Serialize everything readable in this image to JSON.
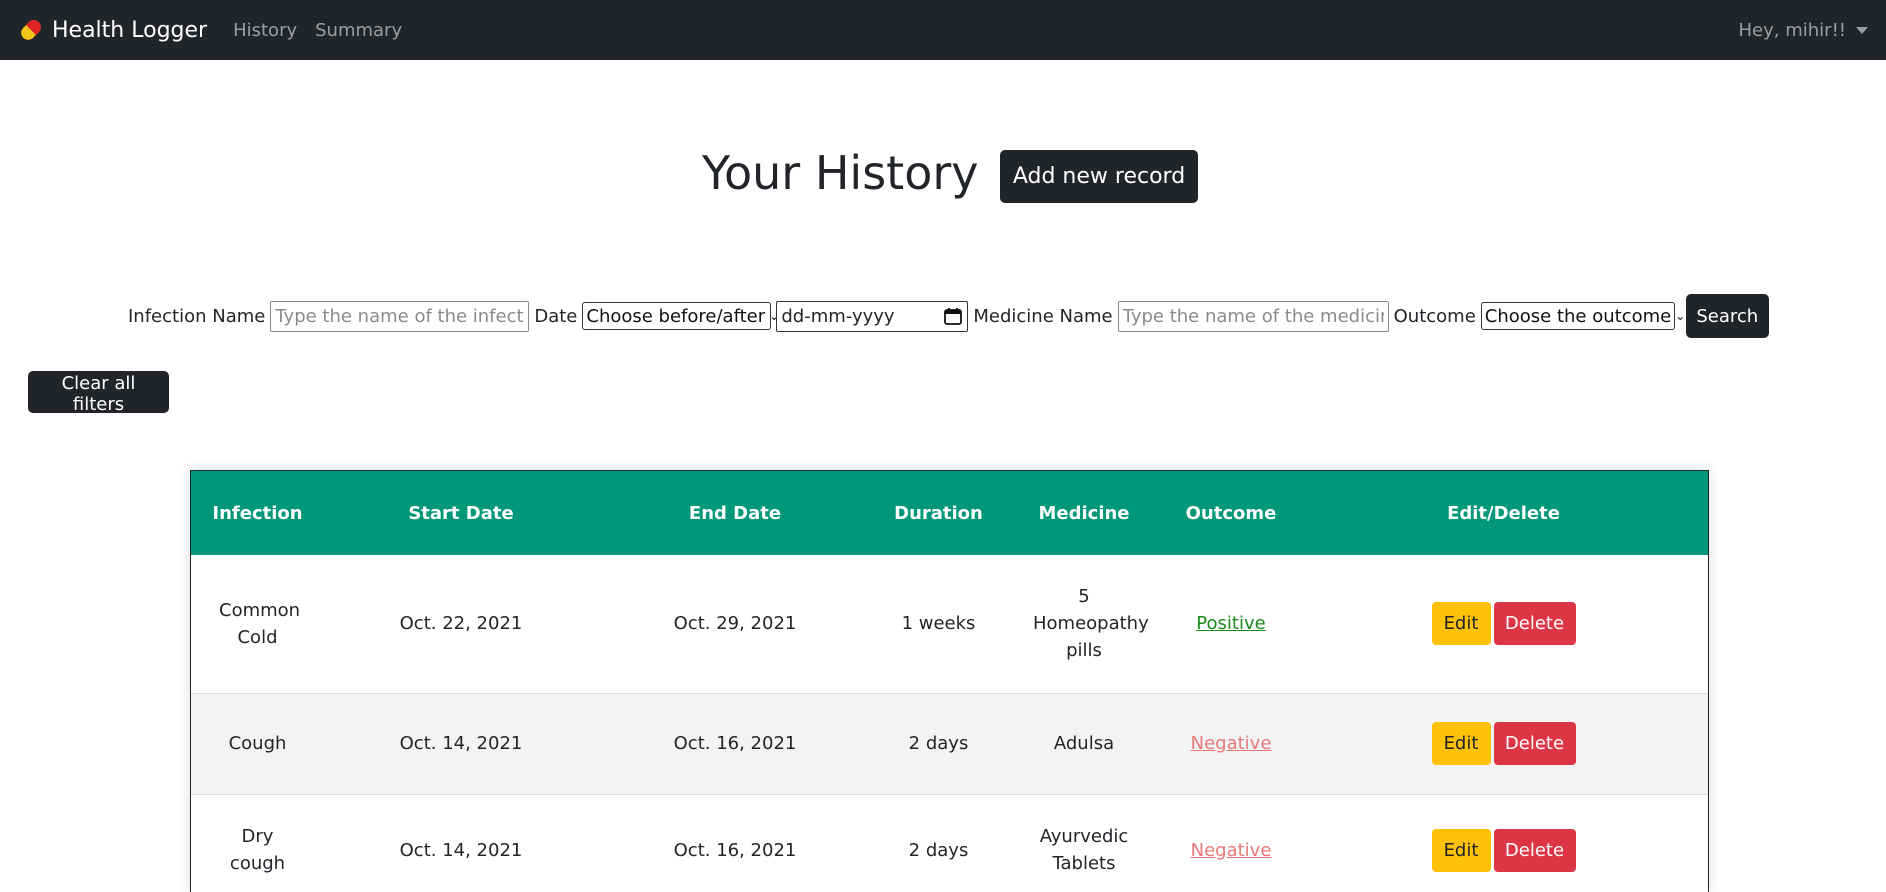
{
  "navbar": {
    "brand": "Health Logger",
    "links": [
      "History",
      "Summary"
    ],
    "user_greeting": "Hey, mihir!!"
  },
  "header": {
    "title": "Your History",
    "add_button": "Add new record"
  },
  "filters": {
    "infection_label": "Infection Name",
    "infection_placeholder": "Type the name of the infection",
    "date_label": "Date",
    "date_select": "Choose before/after",
    "date_value": "dd-mm-yyyy",
    "medicine_label": "Medicine Name",
    "medicine_placeholder": "Type the name of the medicine",
    "outcome_label": "Outcome",
    "outcome_select": "Choose the outcome",
    "search_button": "Search",
    "clear_button": "Clear all filters"
  },
  "table": {
    "headers": [
      "Infection",
      "Start Date",
      "End Date",
      "Duration",
      "Medicine",
      "Outcome",
      "Edit/Delete"
    ],
    "rows": [
      {
        "infection": "Common Cold",
        "start": "Oct. 22, 2021",
        "end": "Oct. 29, 2021",
        "duration": "1 weeks",
        "medicine": "5 Homeopathy pills",
        "outcome": "Positive"
      },
      {
        "infection": "Cough",
        "start": "Oct. 14, 2021",
        "end": "Oct. 16, 2021",
        "duration": "2 days",
        "medicine": "Adulsa",
        "outcome": "Negative"
      },
      {
        "infection": "Dry cough",
        "start": "Oct. 14, 2021",
        "end": "Oct. 16, 2021",
        "duration": "2 days",
        "medicine": "Ayurvedic Tablets",
        "outcome": "Negative"
      }
    ],
    "edit_label": "Edit",
    "delete_label": "Delete"
  },
  "colors": {
    "navbar_bg": "#212529",
    "table_header_bg": "#009879",
    "edit_button": "#ffc107",
    "delete_button": "#dc3545",
    "positive_text": "#1a8a1a",
    "negative_text": "#e87878"
  },
  "icons": {
    "brand": "pill-icon",
    "user_menu": "caret-down-icon",
    "date_picker": "calendar-icon",
    "select_arrow": "chevron-down-icon"
  }
}
